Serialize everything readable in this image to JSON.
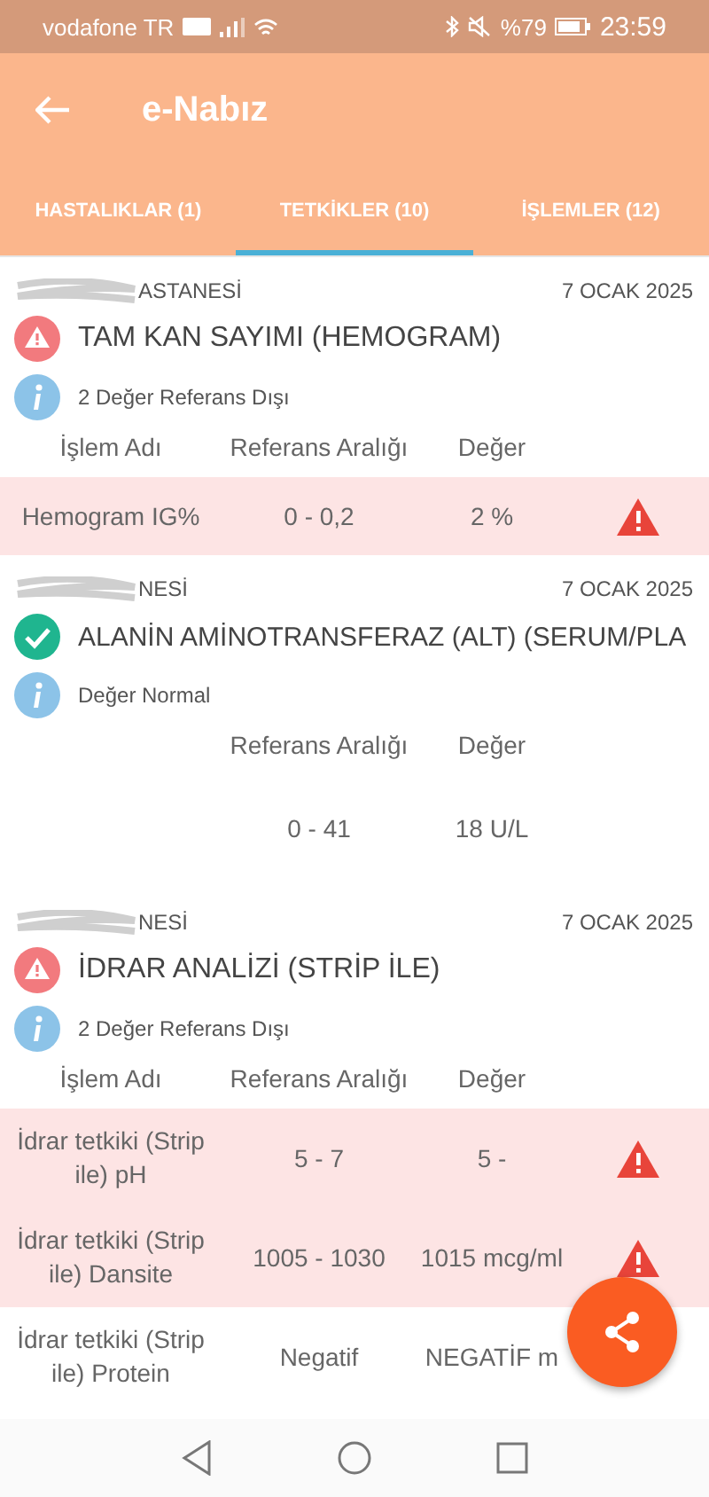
{
  "status_bar": {
    "carrier": "vodafone TR",
    "battery": "%79",
    "time": "23:59"
  },
  "app_bar": {
    "title": "e-Nabız"
  },
  "tabs": [
    {
      "label": "HASTALIKLAR (1)",
      "selected": false
    },
    {
      "label": "TETKİKLER (10)",
      "selected": true
    },
    {
      "label": "İŞLEMLER (12)",
      "selected": false
    }
  ],
  "cards": [
    {
      "hospital": "ASTANESİ",
      "date": "7 OCAK 2025",
      "kind": "warning",
      "title": "TAM KAN SAYIMI (HEMOGRAM)",
      "summary": "2 Değer Referans Dışı",
      "header": {
        "name": "İşlem Adı",
        "range": "Referans Aralığı",
        "value": "Değer"
      },
      "rows": [
        {
          "name": "Hemogram IG%",
          "range": "0 - 0,2",
          "value": "2 %",
          "abnormal": true
        }
      ]
    },
    {
      "hospital": "NESİ",
      "date": "7 OCAK 2025",
      "kind": "normal",
      "title": "ALANİN AMİNOTRANSFERAZ (ALT) (SERUM/PLA",
      "summary": "Değer Normal",
      "header": {
        "range": "Referans Aralığı",
        "value": "Değer"
      },
      "rows": [
        {
          "range": "0 - 41",
          "value": "18 U/L",
          "abnormal": false
        }
      ]
    },
    {
      "hospital": "NESİ",
      "date": "7 OCAK 2025",
      "kind": "warning",
      "title": "İDRAR ANALİZİ (STRİP İLE)",
      "summary": "2 Değer Referans Dışı",
      "header": {
        "name": "İşlem Adı",
        "range": "Referans Aralığı",
        "value": "Değer"
      },
      "rows": [
        {
          "name": "İdrar tetkiki (Strip ile) pH",
          "range": "5 - 7",
          "value": "5 -",
          "abnormal": true
        },
        {
          "name": "İdrar tetkiki (Strip ile) Dansite",
          "range": "1005 - 1030",
          "value": "1015 mcg/ml",
          "abnormal": true
        },
        {
          "name": "İdrar tetkiki (Strip ile) Protein",
          "range": "Negatif",
          "value": "NEGATİF m",
          "abnormal": false
        }
      ]
    }
  ]
}
